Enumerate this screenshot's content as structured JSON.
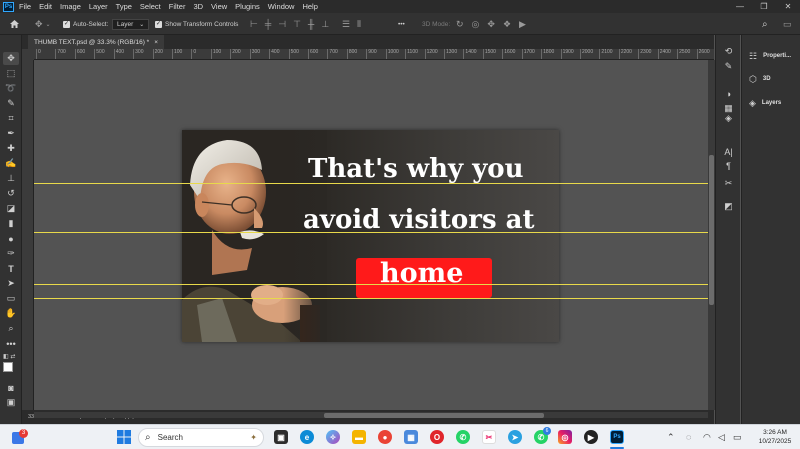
{
  "menubar": {
    "logo": "Ps",
    "items": [
      "File",
      "Edit",
      "Image",
      "Layer",
      "Type",
      "Select",
      "Filter",
      "3D",
      "View",
      "Plugins",
      "Window",
      "Help"
    ],
    "window_controls": [
      "—",
      "❐",
      "✕"
    ]
  },
  "optionsbar": {
    "home_icon": "home-icon",
    "auto_select_label": "Auto-Select:",
    "auto_select_checked": true,
    "layer_select_value": "Layer",
    "show_transform_label": "Show Transform Controls",
    "show_transform_checked": true,
    "mode_3d_label": "3D Mode:",
    "more_label": "•••"
  },
  "document_tab": {
    "title": "THUMB TEXT.psd @ 33.3% (RGB/16) *",
    "close": "×"
  },
  "ruler": {
    "ticks": [
      "0",
      "700",
      "600",
      "500",
      "400",
      "300",
      "200",
      "100",
      "0",
      "100",
      "200",
      "300",
      "400",
      "500",
      "600",
      "700",
      "800",
      "900",
      "1000",
      "1100",
      "1200",
      "1300",
      "1400",
      "1500",
      "1600",
      "1700",
      "1800",
      "1900",
      "2000",
      "2100",
      "2200",
      "2300",
      "2400",
      "2500",
      "2600"
    ]
  },
  "artboard": {
    "line1": "That's why you",
    "line2": "avoid visitors at",
    "line3": "home",
    "accent_color": "#ff1a1a",
    "guide_color": "#e8d94a"
  },
  "statusbar": {
    "zoom": "33.33%",
    "doc_info": "1920 px x 1080 px (300 ppi)",
    "arrow": "›"
  },
  "right_panels": {
    "items": [
      {
        "label": "Properti...",
        "icon": "properties-icon"
      },
      {
        "label": "3D",
        "icon": "cube-icon"
      },
      {
        "label": "Layers",
        "icon": "layers-icon"
      }
    ]
  },
  "taskbar": {
    "search_placeholder": "Search",
    "time": "3:26 AM",
    "date": "10/27/2025",
    "notification_count": "3",
    "whatsapp_badge": "6"
  }
}
